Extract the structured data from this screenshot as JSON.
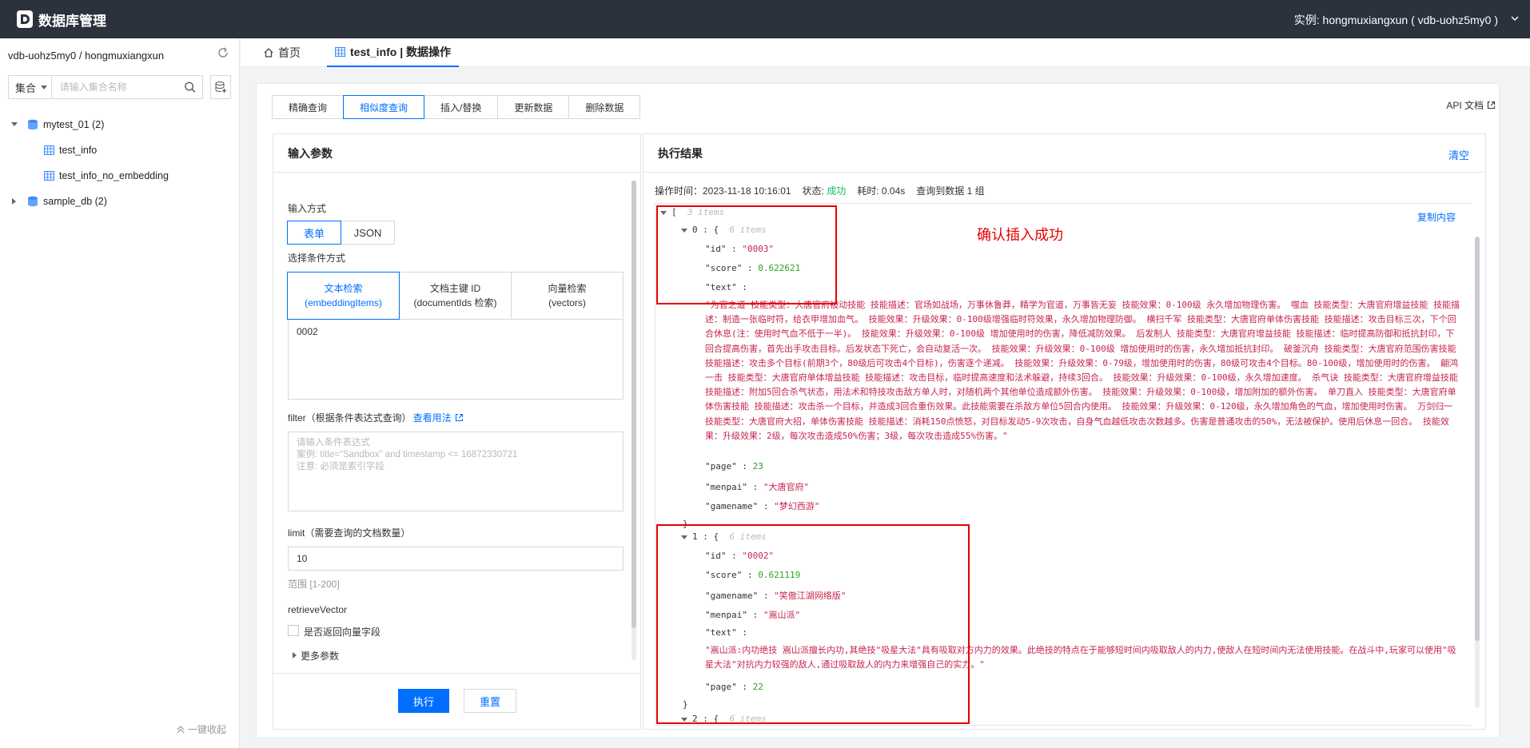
{
  "app": {
    "title": "数据库管理",
    "instance_label": "实例: hongmuxiangxun ( vdb-uohz5my0 )"
  },
  "sidebar": {
    "header": "vdb-uohz5my0 / hongmuxiangxun",
    "scope": "集合",
    "search_placeholder": "请输入集合名称",
    "tree": [
      {
        "label": "mytest_01 (2)"
      },
      {
        "label": "test_info"
      },
      {
        "label": "test_info_no_embedding"
      },
      {
        "label": "sample_db (2)"
      }
    ],
    "collapse_label": "一键收起"
  },
  "tabs": [
    {
      "label": "首页"
    },
    {
      "label": "test_info | 数据操作"
    }
  ],
  "op_tabs": [
    "精确查询",
    "相似度查询",
    "插入/替换",
    "更新数据",
    "删除数据"
  ],
  "api_doc": "API 文档",
  "input_panel": {
    "title": "输入参数",
    "input_mode_label": "输入方式",
    "modes": [
      "表单",
      "JSON"
    ],
    "condition_label": "选择条件方式",
    "conditions": [
      {
        "line1": "文本检索",
        "line2": "(embeddingItems)"
      },
      {
        "line1": "文档主键 ID",
        "line2": "(documentIds 检索)"
      },
      {
        "line1": "向量检索",
        "line2": "(vectors)"
      }
    ],
    "condition_value": "0002",
    "filter_label": "filter（根据条件表达式查询）",
    "filter_link": "查看用法",
    "filter_placeholder": [
      "请输入条件表达式",
      "案例: title=\"Sandbox\" and timestamp <= 16872330721",
      "注意: 必须是索引字段"
    ],
    "limit_label": "limit（需要查询的文档数量）",
    "limit_value": "10",
    "limit_range": "范围 [1-200]",
    "retrieve_label": "retrieveVector",
    "retrieve_checkbox": "是否返回向量字段",
    "more_params": "更多参数",
    "run_button": "执行",
    "reset_button": "重置"
  },
  "result_panel": {
    "title": "执行结果",
    "clear": "清空",
    "meta": {
      "time": "操作时间：2023-11-18 10:16:01",
      "status_label": "状态:",
      "status": "成功",
      "elapsed": "耗时: 0.04s",
      "found": "查询到数据 1 组"
    },
    "copy": "复制内容",
    "json": {
      "root_count": "3 items",
      "item0": {
        "index": "0",
        "count": "6 items",
        "id": "\"0003\"",
        "score": "0.622621",
        "text": "\"为官之道 技能类型：大唐官府被动技能 技能描述：官场如战场，万事休鲁莽，精学为官道，万事皆无妄 技能效果：0-100级 永久增加物理伤害。 噬血 技能类型：大唐官府增益技能 技能描述：制造一张临时符，给衣甲增加血气。 技能效果：升级效果：0-100级增强临时符效果，永久增加物理防御。 横扫千军 技能类型：大唐官府单体伤害技能 技能描述：攻击目标三次，下个回合休息(注：使用时气血不低于一半)。 技能效果：升级效果：0-100级 增加使用时的伤害，降低减防效果。 后发制人 技能类型：大唐官府增益技能 技能描述：临时提高防御和抵抗封印，下回合提高伤害，首先出手攻击目标。后发状态下死亡，会自动复活一次。 技能效果：升级效果：0-100级 增加使用时的伤害，永久增加抵抗封印。 破釜沉舟 技能类型：大唐官府范围伤害技能 技能描述：攻击多个目标(前期3个，80级后可攻击4个目标)，伤害逐个递减。 技能效果：升级效果：0-79级，增加使用时的伤害，80级可攻击4个目标。80-100级，增加使用时的伤害。 翩鸿一击 技能类型：大唐官府单体增益技能 技能描述：攻击目标，临时提高速度和法术躲避，持续3回合。 技能效果：升级效果：0-100级，永久增加速度。 杀气诀 技能类型：大唐官府增益技能 技能描述：附加5回合杀气状态，用法术和特技攻击敌方单人时，对随机两个其他单位造成额外伤害。 技能效果：升级效果：0-100级，增加附加的额外伤害。 单刀直入 技能类型：大唐官府单体伤害技能 技能描述：攻击杀一个目标，并造成3回合重伤效果。此技能需要在杀敌方单位5回合内使用。 技能效果：升级效果：0-120级，永久增加角色的气血，增加使用时伤害。 万剑归一 技能类型：大唐官府大招，单体伤害技能 技能描述：消耗150点愤怒，对目标发动5-9次攻击，自身气血越低攻击次数越多。伤害是普通攻击的50%，无法被保护。使用后休息一回合。 技能效果：升级效果：2级，每次攻击造成50%伤害；3级，每次攻击造成55%伤害。\"",
        "page": "23",
        "menpai": "\"大唐官府\"",
        "gamename": "\"梦幻西游\""
      },
      "item1": {
        "index": "1",
        "count": "6 items",
        "id": "\"0002\"",
        "score": "0.621119",
        "gamename": "\"笑傲江湖网络版\"",
        "menpai": "\"嵩山派\"",
        "text": "\"嵩山派:内功绝技 嵩山派擅长内功,其绝技\"吸星大法\"具有吸取对方内力的效果。此绝技的特点在于能够短时间内吸取敌人的内力,使敌人在短时间内无法使用技能。在战斗中,玩家可以使用\"吸星大法\"对抗内力较强的敌人,通过吸取敌人的内力来增强自己的实力。\"",
        "page": "22"
      },
      "item2": {
        "index": "2",
        "count": "6 items"
      }
    },
    "annotation": "确认插入成功"
  }
}
